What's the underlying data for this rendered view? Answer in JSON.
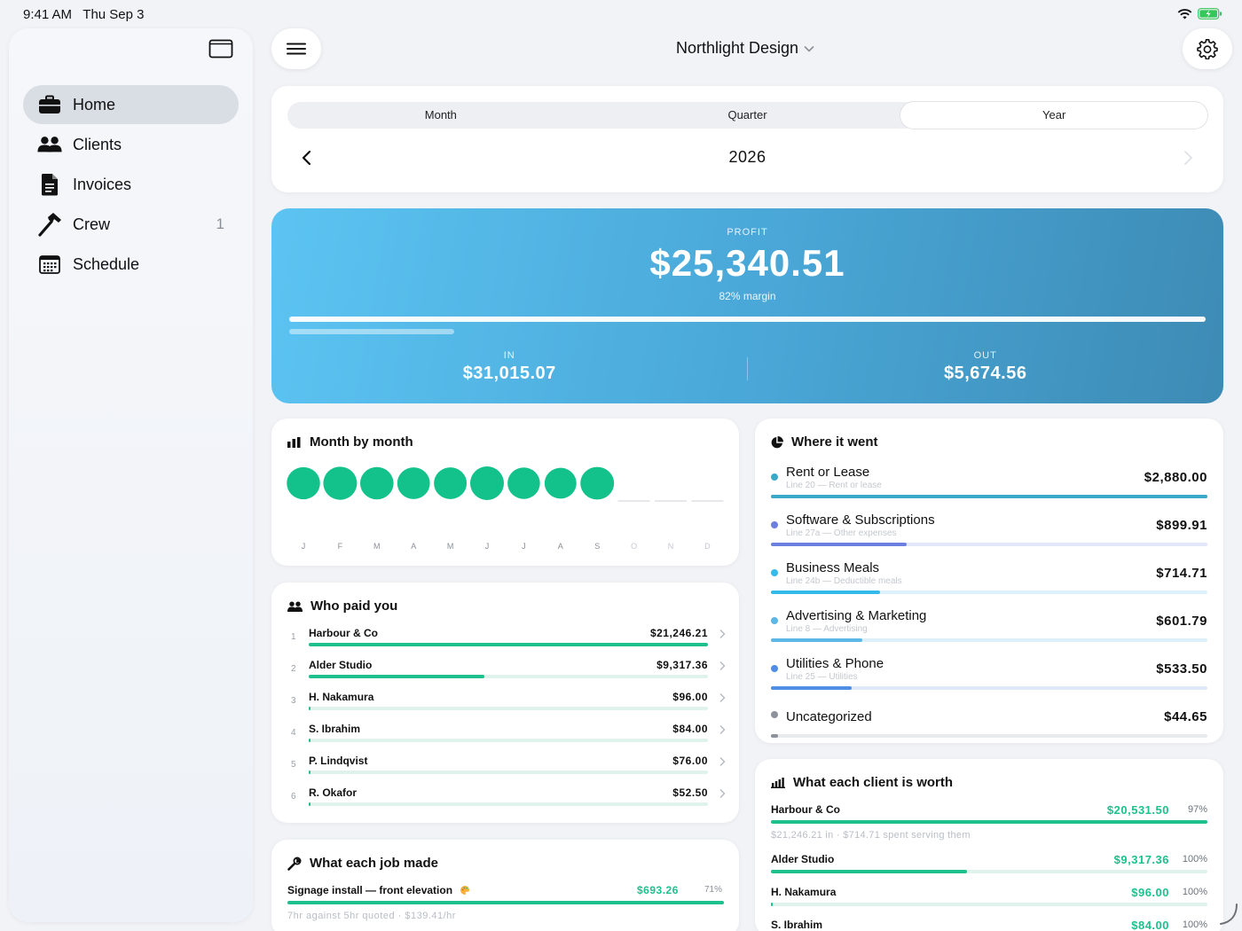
{
  "status": {
    "time": "9:41 AM",
    "date": "Thu Sep 3"
  },
  "sidebar": {
    "items": [
      {
        "label": "Home",
        "icon": "briefcase-icon",
        "active": true,
        "badge": ""
      },
      {
        "label": "Clients",
        "icon": "people-icon",
        "active": false,
        "badge": ""
      },
      {
        "label": "Invoices",
        "icon": "document-icon",
        "active": false,
        "badge": ""
      },
      {
        "label": "Crew",
        "icon": "hammer-icon",
        "active": false,
        "badge": "1"
      },
      {
        "label": "Schedule",
        "icon": "calendar-icon",
        "active": false,
        "badge": ""
      }
    ]
  },
  "header": {
    "title": "Northlight Design"
  },
  "period": {
    "tabs": [
      "Month",
      "Quarter",
      "Year"
    ],
    "active_tab": 2,
    "year": "2026"
  },
  "profit": {
    "kicker": "PROFIT",
    "value": "$25,340.51",
    "margin": "82% margin",
    "out_fraction": 0.18,
    "in_label": "IN",
    "in_value": "$31,015.07",
    "out_label": "OUT",
    "out_value": "$5,674.56",
    "gradient_start": "#5cc4f2",
    "gradient_end": "#3d8bb5"
  },
  "month_by_month": {
    "title": "Month by month",
    "accent": "#12c28a",
    "chart_data": {
      "type": "bar",
      "categories": [
        "J",
        "F",
        "M",
        "A",
        "M",
        "J",
        "J",
        "A",
        "S",
        "O",
        "N",
        "D"
      ],
      "values": [
        2900,
        3300,
        2950,
        2600,
        2650,
        3600,
        2500,
        2200,
        3100,
        0,
        0,
        0
      ]
    }
  },
  "who_paid": {
    "title": "Who paid you",
    "rows": [
      {
        "rank": "1",
        "name": "Harbour & Co",
        "amount": "$21,246.21",
        "fraction": 1.0
      },
      {
        "rank": "2",
        "name": "Alder Studio",
        "amount": "$9,317.36",
        "fraction": 0.44
      },
      {
        "rank": "3",
        "name": "H. Nakamura",
        "amount": "$96.00",
        "fraction": 0.005
      },
      {
        "rank": "4",
        "name": "S. Ibrahim",
        "amount": "$84.00",
        "fraction": 0.004
      },
      {
        "rank": "5",
        "name": "P. Lindqvist",
        "amount": "$76.00",
        "fraction": 0.004
      },
      {
        "rank": "6",
        "name": "R. Okafor",
        "amount": "$52.50",
        "fraction": 0.003
      }
    ]
  },
  "job": {
    "title": "What each job made",
    "name": "Signage install — front elevation",
    "amount": "$693.26",
    "pct": "71%",
    "fraction": 1.0,
    "sub": "7hr against 5hr quoted · $139.41/hr"
  },
  "where_went": {
    "title": "Where it went",
    "rows": [
      {
        "name": "Rent or Lease",
        "sub": "Line 20 — Rent or lease",
        "amount": "$2,880.00",
        "fraction": 1.0,
        "color": "#3aa8c9",
        "track": "#d9eef5"
      },
      {
        "name": "Software & Subscriptions",
        "sub": "Line 27a — Other expenses",
        "amount": "$899.91",
        "fraction": 0.31,
        "color": "#6b7fe0",
        "track": "#e3e7fa"
      },
      {
        "name": "Business Meals",
        "sub": "Line 24b — Deductible meals",
        "amount": "$714.71",
        "fraction": 0.25,
        "color": "#35b8ea",
        "track": "#dcf1fb"
      },
      {
        "name": "Advertising & Marketing",
        "sub": "Line 8 — Advertising",
        "amount": "$601.79",
        "fraction": 0.21,
        "color": "#5bb7e6",
        "track": "#ddf0fa"
      },
      {
        "name": "Utilities & Phone",
        "sub": "Line 25 — Utilities",
        "amount": "$533.50",
        "fraction": 0.185,
        "color": "#4f8ee3",
        "track": "#dde8f8"
      },
      {
        "name": "Uncategorized",
        "sub": "",
        "amount": "$44.65",
        "fraction": 0.016,
        "color": "#8e939b",
        "track": "#e8eaed"
      }
    ]
  },
  "client_worth": {
    "title": "What each client is worth",
    "rows": [
      {
        "name": "Harbour & Co",
        "amount": "$20,531.50",
        "pct": "97%",
        "fraction": 1.0,
        "sub": "$21,246.21 in · $714.71 spent serving them"
      },
      {
        "name": "Alder Studio",
        "amount": "$9,317.36",
        "pct": "100%",
        "fraction": 0.45,
        "sub": ""
      },
      {
        "name": "H. Nakamura",
        "amount": "$96.00",
        "pct": "100%",
        "fraction": 0.005,
        "sub": ""
      },
      {
        "name": "S. Ibrahim",
        "amount": "$84.00",
        "pct": "100%",
        "fraction": 0.004,
        "sub": ""
      }
    ]
  }
}
